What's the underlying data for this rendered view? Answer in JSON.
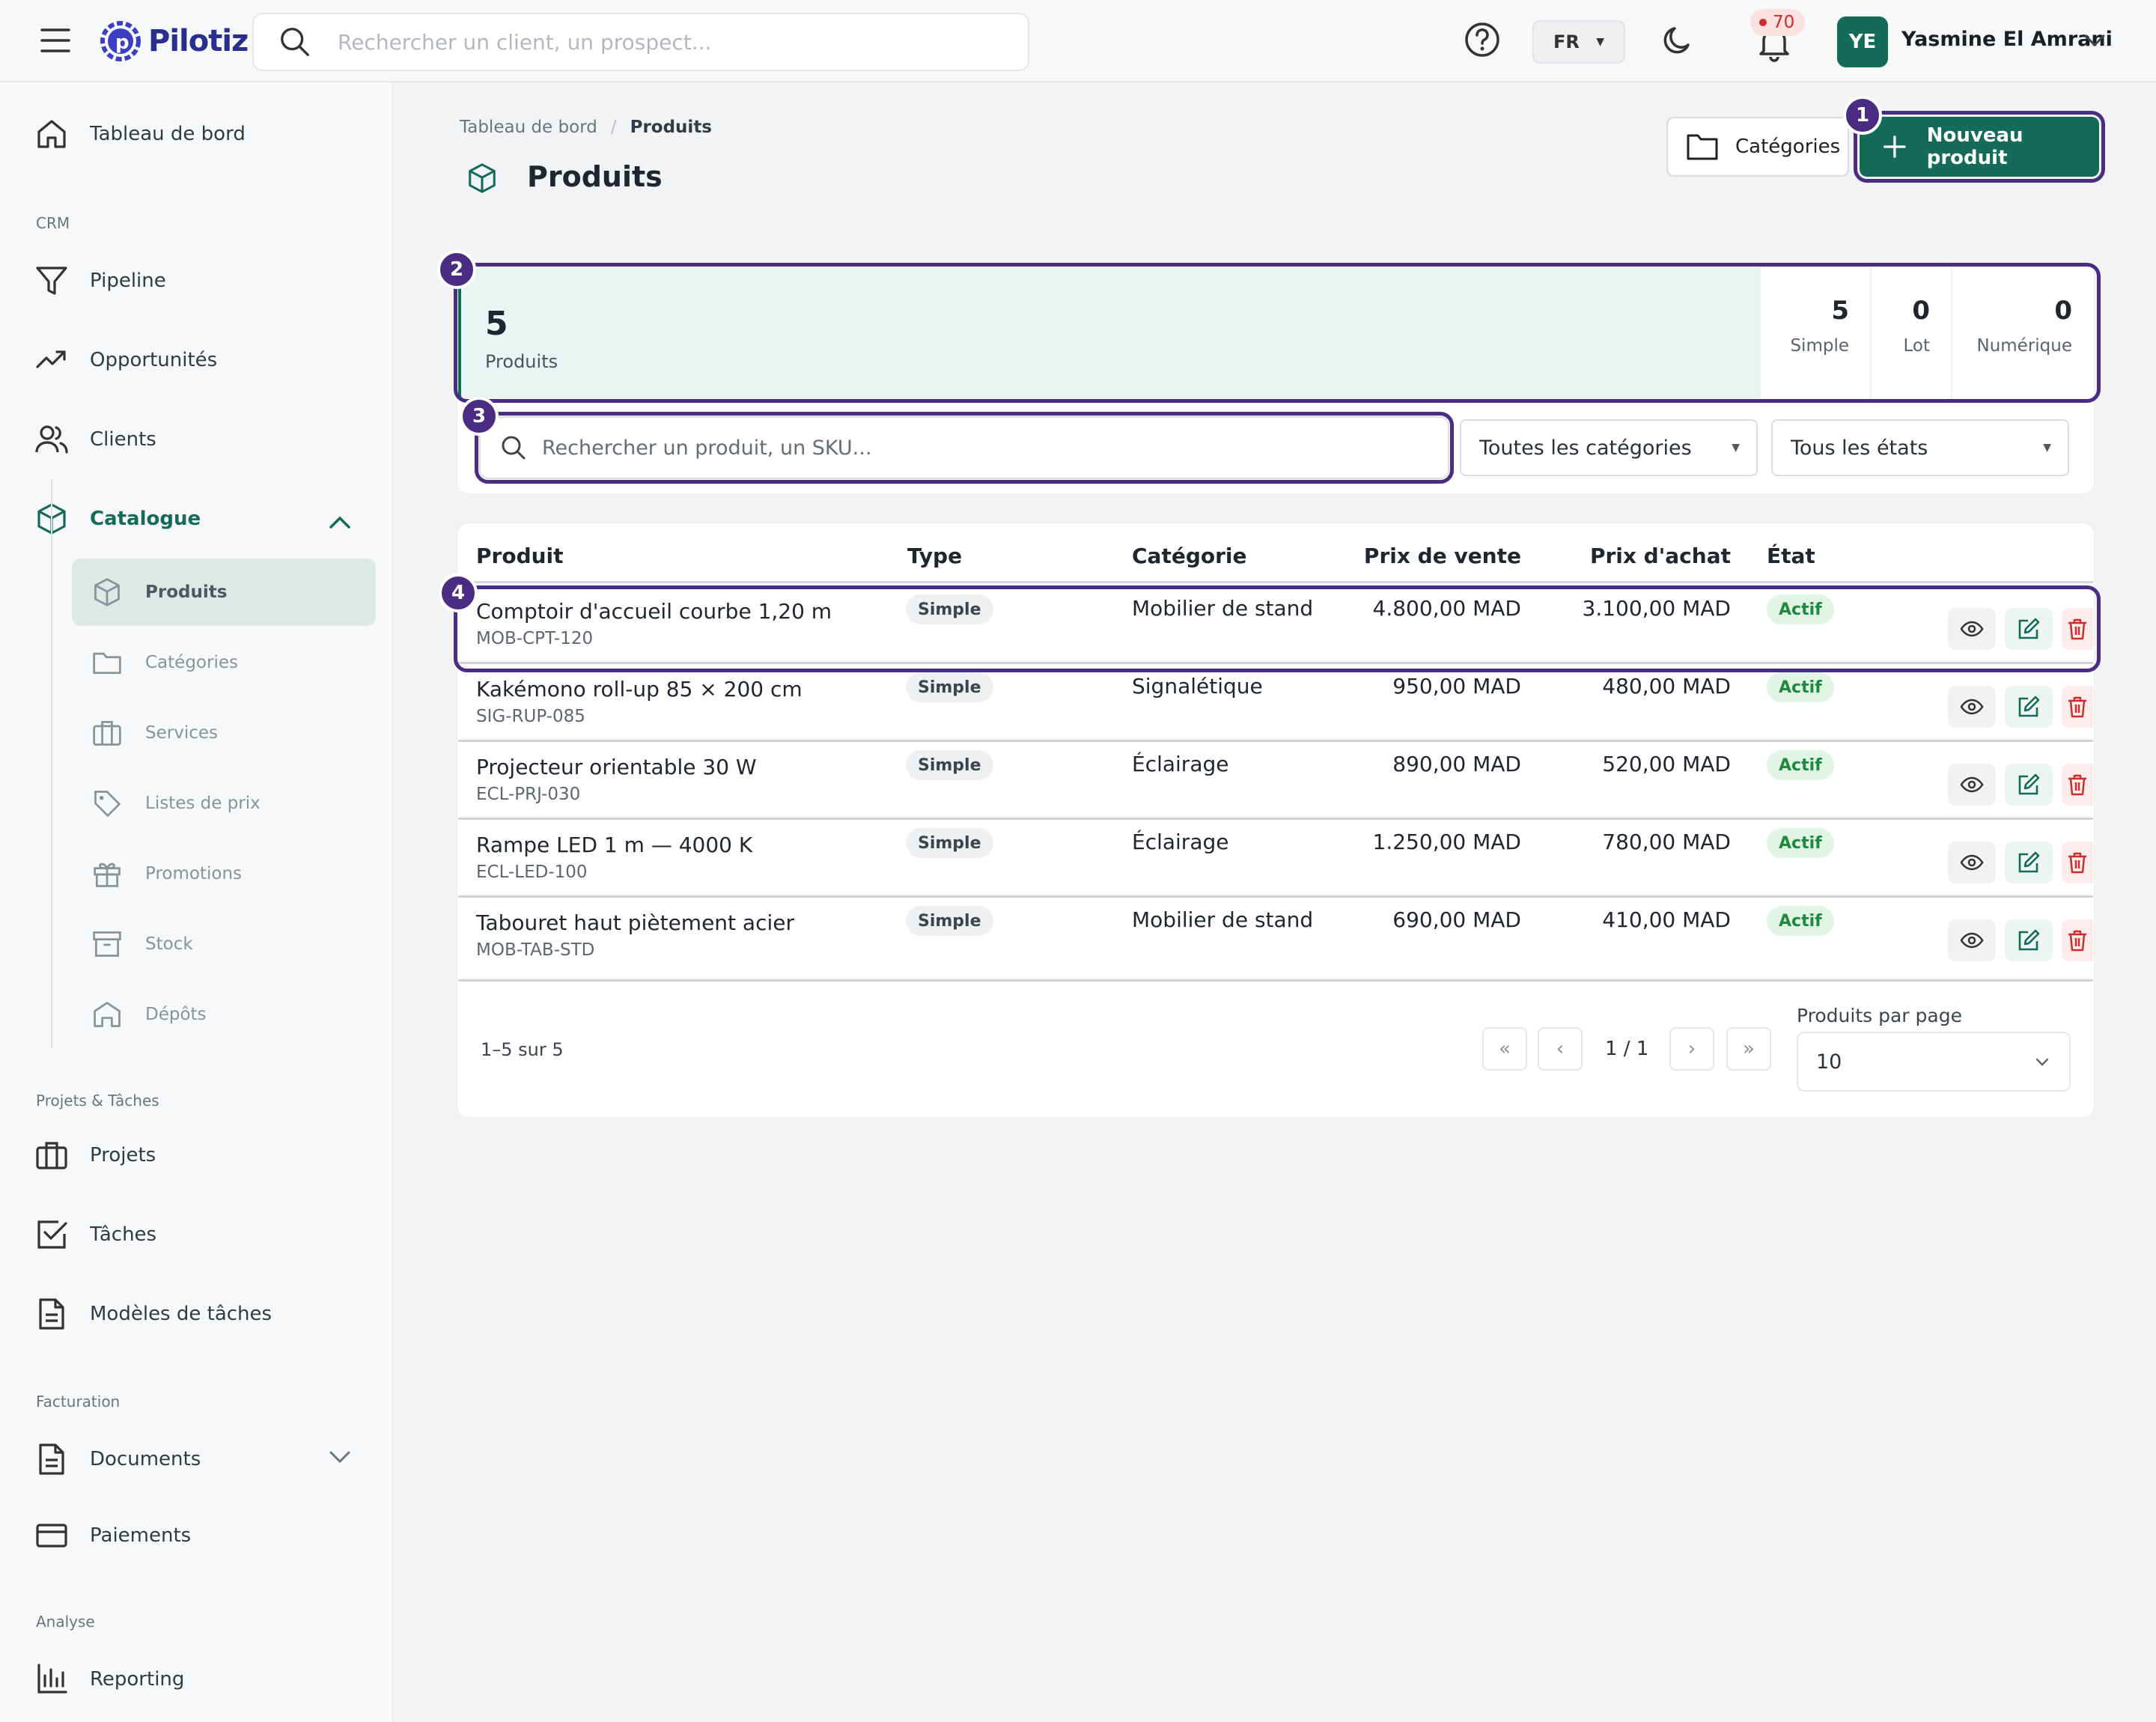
{
  "app": {
    "brand": "Pilotiz",
    "search_placeholder": "Rechercher un client, un prospect...",
    "lang": "FR",
    "notifications_count": "70",
    "user_initials": "YE",
    "user_name": "Yasmine El Amrani",
    "accent": "#146b57",
    "highlight": "#4a2c83"
  },
  "sidebar": {
    "dashboard": "Tableau de bord",
    "sections": {
      "crm": "CRM",
      "projects": "Projets & Tâches",
      "billing": "Facturation",
      "analysis": "Analyse"
    },
    "crm": [
      "Pipeline",
      "Opportunités",
      "Clients",
      "Catalogue"
    ],
    "catalogue_sub": [
      "Produits",
      "Catégories",
      "Services",
      "Listes de prix",
      "Promotions",
      "Stock",
      "Dépôts"
    ],
    "projects": [
      "Projets",
      "Tâches",
      "Modèles de tâches"
    ],
    "billing": [
      "Documents",
      "Paiements"
    ],
    "analysis": [
      "Reporting"
    ]
  },
  "page": {
    "breadcrumb_home": "Tableau de bord",
    "breadcrumb_current": "Produits",
    "title": "Produits",
    "btn_categories": "Catégories",
    "btn_new": "Nouveau produit"
  },
  "markers": [
    "1",
    "2",
    "3",
    "4"
  ],
  "stats": {
    "total": "5",
    "total_label": "Produits",
    "simple": "5",
    "simple_label": "Simple",
    "lot": "0",
    "lot_label": "Lot",
    "numeric": "0",
    "numeric_label": "Numérique"
  },
  "filters": {
    "search_placeholder": "Rechercher un produit, un SKU...",
    "category": "Toutes les catégories",
    "state": "Tous les états"
  },
  "table": {
    "headers": {
      "product": "Produit",
      "type": "Type",
      "category": "Catégorie",
      "sale_price": "Prix de vente",
      "purchase_price": "Prix d'achat",
      "state": "État"
    },
    "rows": [
      {
        "name": "Comptoir d'accueil courbe 1,20 m",
        "sku": "MOB-CPT-120",
        "type": "Simple",
        "category": "Mobilier de stand",
        "sale": "4.800,00 MAD",
        "purchase": "3.100,00 MAD",
        "state": "Actif"
      },
      {
        "name": "Kakémono roll-up 85 × 200 cm",
        "sku": "SIG-RUP-085",
        "type": "Simple",
        "category": "Signalétique",
        "sale": "950,00 MAD",
        "purchase": "480,00 MAD",
        "state": "Actif"
      },
      {
        "name": "Projecteur orientable 30 W",
        "sku": "ECL-PRJ-030",
        "type": "Simple",
        "category": "Éclairage",
        "sale": "890,00 MAD",
        "purchase": "520,00 MAD",
        "state": "Actif"
      },
      {
        "name": "Rampe LED 1 m — 4000 K",
        "sku": "ECL-LED-100",
        "type": "Simple",
        "category": "Éclairage",
        "sale": "1.250,00 MAD",
        "purchase": "780,00 MAD",
        "state": "Actif"
      },
      {
        "name": "Tabouret haut piètement acier",
        "sku": "MOB-TAB-STD",
        "type": "Simple",
        "category": "Mobilier de stand",
        "sale": "690,00 MAD",
        "purchase": "410,00 MAD",
        "state": "Actif"
      }
    ]
  },
  "pagination": {
    "info": "1–5 sur 5",
    "page": "1 / 1",
    "per_page_label": "Produits par page",
    "per_page": "10"
  }
}
